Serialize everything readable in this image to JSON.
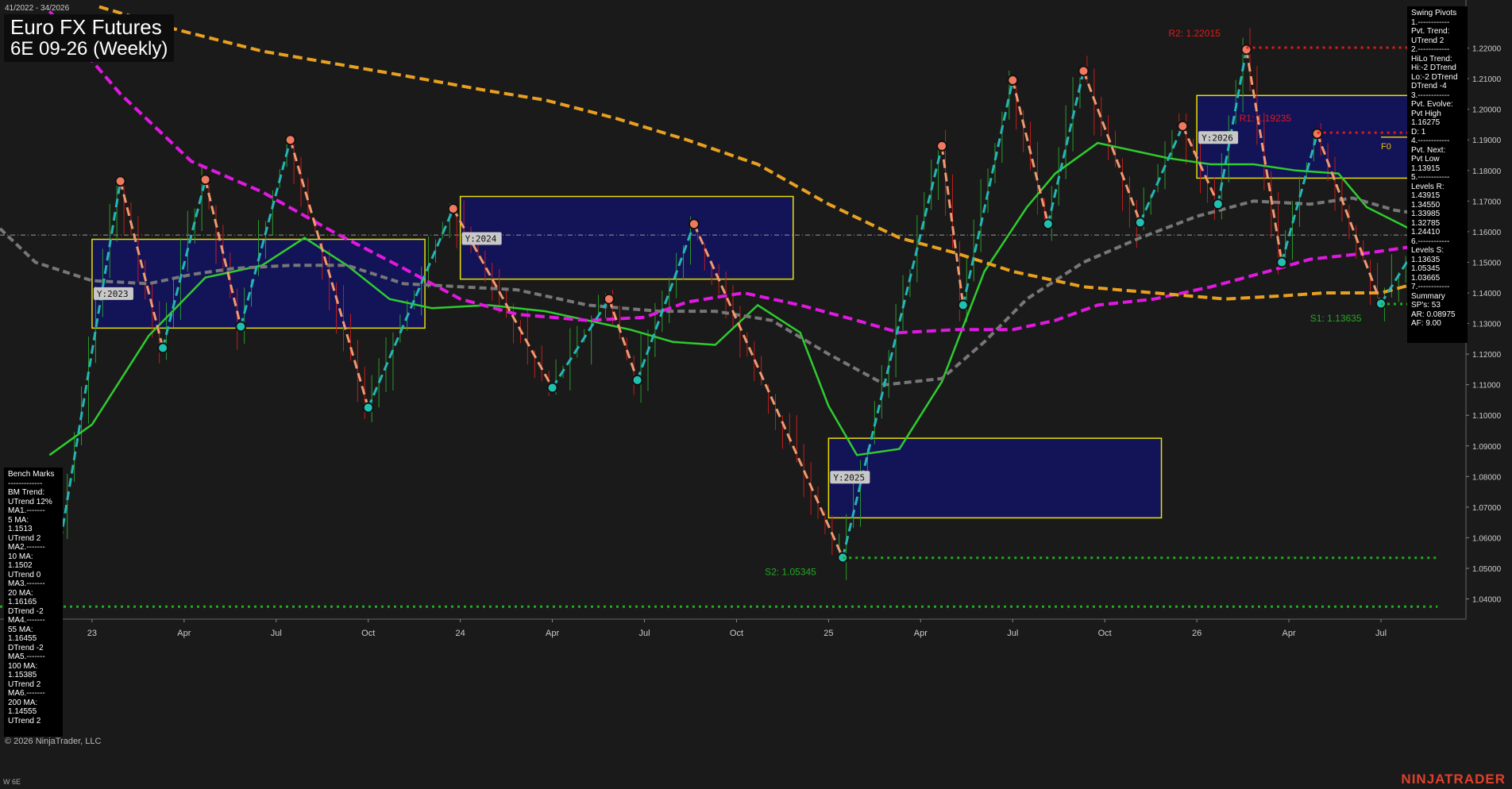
{
  "header": {
    "date_range": "41/2022 - 34/2026",
    "title": "Euro FX Futures",
    "subtitle": "6E 09-26 (Weekly)"
  },
  "footer": {
    "copyright": "© 2026 NinjaTrader, LLC",
    "instrument": "W 6E",
    "brand": "NINJATRADER"
  },
  "swing_panel": {
    "lines": [
      "Swing Pivots",
      "1.------------",
      "Pvt. Trend:",
      "UTrend 2",
      "2.------------",
      "HiLo Trend:",
      "Hi:-2 DTrend",
      "Lo:-2 DTrend",
      "DTrend -4",
      "3.------------",
      "Pvt. Evolve:",
      "Pvt High",
      "1.16275",
      "D: 1",
      "4.------------",
      "Pvt. Next:",
      "Pvt Low",
      "1.13915",
      "5.------------",
      "Levels R:",
      "1.43915",
      "1.34550",
      "1.33985",
      "1.32785",
      "1.24410",
      "6.------------",
      "Levels S:",
      "1.13635",
      "1.05345",
      "1.03665",
      "7.------------",
      "Summary",
      "SP's: 53",
      "AR: 0.08975",
      "AF: 9.00"
    ]
  },
  "bench_panel": {
    "lines": [
      "Bench Marks",
      "-------------",
      "BM Trend:",
      "UTrend 12%",
      "MA1.-------",
      "5 MA:",
      "1.1513",
      "UTrend 2",
      "MA2.-------",
      "10 MA:",
      "1.1502",
      "UTrend 0",
      "MA3.-------",
      "20 MA:",
      "1.16165",
      "DTrend -2",
      "MA4.-------",
      "55 MA:",
      "1.16455",
      "DTrend -2",
      "MA5.-------",
      "100 MA:",
      "1.15385",
      "UTrend 2",
      "MA6.-------",
      "200 MA:",
      "1.14555",
      "UTrend 2"
    ]
  },
  "chart_data": {
    "type": "ohlc",
    "y_ticks": [
      1.04,
      1.05,
      1.06,
      1.07,
      1.08,
      1.09,
      1.1,
      1.11,
      1.12,
      1.13,
      1.14,
      1.15,
      1.16,
      1.17,
      1.18,
      1.19,
      1.2,
      1.21,
      1.22
    ],
    "y_range": [
      1.0334,
      1.2357
    ],
    "x_labels": [
      {
        "label": "23",
        "w": 0
      },
      {
        "label": "Apr",
        "w": 13
      },
      {
        "label": "Jul",
        "w": 26
      },
      {
        "label": "Oct",
        "w": 39
      },
      {
        "label": "24",
        "w": 52
      },
      {
        "label": "Apr",
        "w": 65
      },
      {
        "label": "Jul",
        "w": 78
      },
      {
        "label": "Oct",
        "w": 91
      },
      {
        "label": "25",
        "w": 104
      },
      {
        "label": "Apr",
        "w": 117
      },
      {
        "label": "Jul",
        "w": 130
      },
      {
        "label": "Oct",
        "w": 143
      },
      {
        "label": "26",
        "w": 156
      },
      {
        "label": "Apr",
        "w": 169
      },
      {
        "label": "Jul",
        "w": 182
      }
    ],
    "x_range": [
      -13,
      194
    ],
    "reference_price": 1.1589,
    "swing_pivots": [
      [
        -6,
        1.0375,
        "L"
      ],
      [
        4,
        1.1765,
        "H"
      ],
      [
        10,
        1.122,
        "L"
      ],
      [
        16,
        1.177,
        "H"
      ],
      [
        21,
        1.129,
        "L"
      ],
      [
        28,
        1.19,
        "H"
      ],
      [
        39,
        1.1025,
        "L"
      ],
      [
        51,
        1.1675,
        "H"
      ],
      [
        65,
        1.109,
        "L"
      ],
      [
        73,
        1.138,
        "H"
      ],
      [
        77,
        1.1115,
        "L"
      ],
      [
        85,
        1.1625,
        "H"
      ],
      [
        106,
        1.0535,
        "L"
      ],
      [
        120,
        1.188,
        "H"
      ],
      [
        123,
        1.136,
        "L"
      ],
      [
        130,
        1.2095,
        "H"
      ],
      [
        135,
        1.1625,
        "L"
      ],
      [
        140,
        1.2125,
        "H"
      ],
      [
        148,
        1.163,
        "L"
      ],
      [
        154,
        1.1945,
        "H"
      ],
      [
        159,
        1.169,
        "L"
      ],
      [
        163,
        1.2195,
        "H"
      ],
      [
        168,
        1.15,
        "L"
      ],
      [
        173,
        1.192,
        "H"
      ],
      [
        182,
        1.1365,
        "L"
      ],
      [
        189,
        1.1625,
        "H"
      ]
    ],
    "moving_averages": [
      {
        "color": "#2fcc2f",
        "style": "solid",
        "points": [
          [
            -6,
            1.087
          ],
          [
            0,
            1.097
          ],
          [
            8,
            1.126
          ],
          [
            16,
            1.145
          ],
          [
            24,
            1.149
          ],
          [
            30,
            1.158
          ],
          [
            36,
            1.149
          ],
          [
            42,
            1.138
          ],
          [
            48,
            1.135
          ],
          [
            56,
            1.136
          ],
          [
            64,
            1.134
          ],
          [
            70,
            1.131
          ],
          [
            76,
            1.128
          ],
          [
            82,
            1.124
          ],
          [
            88,
            1.123
          ],
          [
            94,
            1.136
          ],
          [
            100,
            1.127
          ],
          [
            104,
            1.103
          ],
          [
            108,
            1.087
          ],
          [
            114,
            1.089
          ],
          [
            120,
            1.111
          ],
          [
            126,
            1.147
          ],
          [
            132,
            1.168
          ],
          [
            136,
            1.179
          ],
          [
            142,
            1.189
          ],
          [
            148,
            1.186
          ],
          [
            152,
            1.184
          ],
          [
            158,
            1.182
          ],
          [
            164,
            1.182
          ],
          [
            170,
            1.18
          ],
          [
            176,
            1.179
          ],
          [
            180,
            1.168
          ],
          [
            186,
            1.161
          ],
          [
            190,
            1.162
          ]
        ]
      },
      {
        "color": "#777777",
        "style": "dash",
        "points": [
          [
            -13,
            1.161
          ],
          [
            -8,
            1.15
          ],
          [
            0,
            1.144
          ],
          [
            8,
            1.143
          ],
          [
            14,
            1.146
          ],
          [
            20,
            1.148
          ],
          [
            28,
            1.149
          ],
          [
            36,
            1.149
          ],
          [
            44,
            1.143
          ],
          [
            52,
            1.142
          ],
          [
            60,
            1.141
          ],
          [
            70,
            1.136
          ],
          [
            80,
            1.134
          ],
          [
            88,
            1.134
          ],
          [
            96,
            1.131
          ],
          [
            104,
            1.12
          ],
          [
            112,
            1.11
          ],
          [
            120,
            1.112
          ],
          [
            126,
            1.124
          ],
          [
            132,
            1.138
          ],
          [
            140,
            1.15
          ],
          [
            148,
            1.158
          ],
          [
            156,
            1.165
          ],
          [
            164,
            1.17
          ],
          [
            172,
            1.169
          ],
          [
            178,
            1.171
          ],
          [
            184,
            1.167
          ],
          [
            190,
            1.165
          ]
        ]
      },
      {
        "color": "#e019e0",
        "style": "dash",
        "points": [
          [
            -6,
            1.232
          ],
          [
            4,
            1.205
          ],
          [
            14,
            1.183
          ],
          [
            24,
            1.173
          ],
          [
            34,
            1.16
          ],
          [
            44,
            1.148
          ],
          [
            52,
            1.138
          ],
          [
            60,
            1.133
          ],
          [
            70,
            1.131
          ],
          [
            78,
            1.132
          ],
          [
            84,
            1.137
          ],
          [
            92,
            1.14
          ],
          [
            100,
            1.136
          ],
          [
            108,
            1.131
          ],
          [
            114,
            1.127
          ],
          [
            122,
            1.128
          ],
          [
            130,
            1.128
          ],
          [
            136,
            1.131
          ],
          [
            142,
            1.136
          ],
          [
            150,
            1.138
          ],
          [
            158,
            1.142
          ],
          [
            166,
            1.147
          ],
          [
            172,
            1.151
          ],
          [
            180,
            1.153
          ],
          [
            186,
            1.155
          ],
          [
            189,
            1.154
          ]
        ]
      },
      {
        "color": "#e8a020",
        "style": "dash",
        "points": [
          [
            1,
            1.2335
          ],
          [
            12,
            1.226
          ],
          [
            24,
            1.219
          ],
          [
            34,
            1.215
          ],
          [
            44,
            1.211
          ],
          [
            56,
            1.206
          ],
          [
            64,
            1.203
          ],
          [
            74,
            1.197
          ],
          [
            84,
            1.19
          ],
          [
            94,
            1.182
          ],
          [
            104,
            1.169
          ],
          [
            114,
            1.158
          ],
          [
            122,
            1.153
          ],
          [
            130,
            1.147
          ],
          [
            140,
            1.142
          ],
          [
            150,
            1.14
          ],
          [
            160,
            1.138
          ],
          [
            168,
            1.139
          ],
          [
            174,
            1.14
          ],
          [
            182,
            1.14
          ],
          [
            190,
            1.145
          ]
        ]
      }
    ],
    "year_boxes": [
      {
        "label": "Y:2023",
        "x0": 0,
        "x1": 47,
        "y0": 1.1285,
        "y1": 1.1575,
        "label_w": 0,
        "label_p": 1.1395
      },
      {
        "label": "Y:2024",
        "x0": 52,
        "x1": 99,
        "y0": 1.1445,
        "y1": 1.1715,
        "label_w": 52,
        "label_p": 1.1575
      },
      {
        "label": "Y:2025",
        "x0": 104,
        "x1": 151,
        "y0": 1.0665,
        "y1": 1.0925,
        "label_w": 104,
        "label_p": 1.0795
      },
      {
        "label": "Y:2026",
        "x0": 156,
        "x1": 186,
        "y0": 1.1775,
        "y1": 1.2045,
        "label_w": 156,
        "label_p": 1.1905
      }
    ],
    "levels": [
      {
        "label": "R2: 1.22015",
        "price": 1.22015,
        "color": "#e01a1a",
        "x0": 163,
        "x1": 190,
        "label_w": 152
      },
      {
        "label": "R1: 1.19235",
        "price": 1.19235,
        "color": "#e01a1a",
        "x0": 173,
        "x1": 190,
        "label_w": 162
      },
      {
        "label": "S1: 1.13635",
        "price": 1.13635,
        "color": "#22aa22",
        "x0": 182,
        "x1": 190,
        "label_w": 172
      },
      {
        "label": "S2: 1.05345",
        "price": 1.05345,
        "color": "#22aa22",
        "x0": 106,
        "x1": 190,
        "label_w": 95
      },
      {
        "label": "",
        "price": 1.0375,
        "color": "#22aa22",
        "x0": -13,
        "x1": 190,
        "label_w": 0
      }
    ],
    "f0_label": {
      "label": "F0",
      "w": 182,
      "p": 1.1895,
      "color": "#e8c400"
    },
    "f0_line": {
      "w0": 182,
      "w1": 186,
      "p": 1.1909
    },
    "last_price": 1.1625
  }
}
